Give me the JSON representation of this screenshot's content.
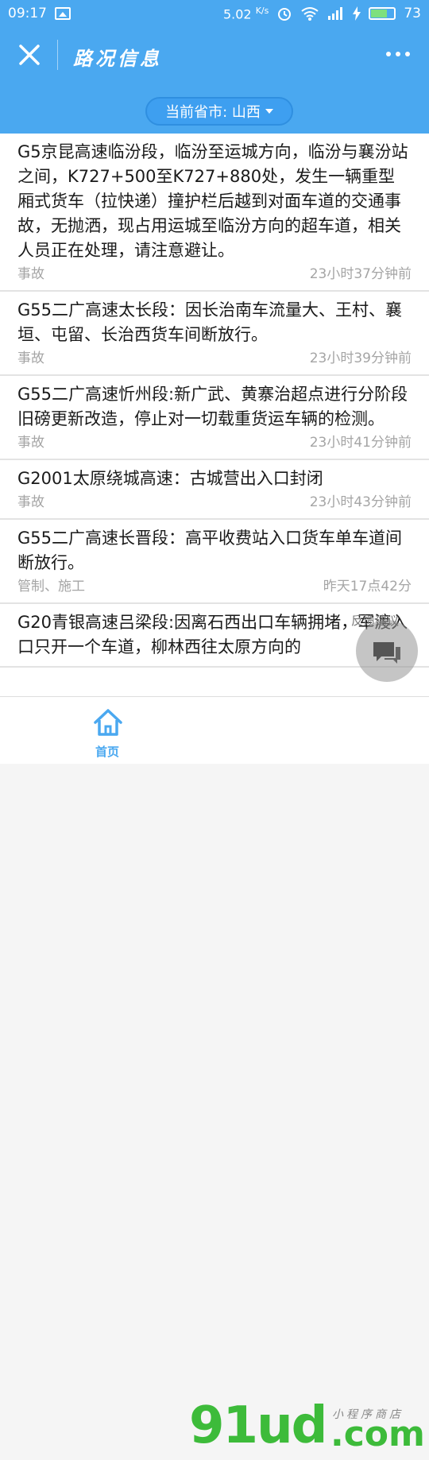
{
  "status_bar": {
    "time": "09:17",
    "speed": "5.02",
    "speed_unit": "K/s",
    "battery": "73",
    "battery_level": 0.73
  },
  "header": {
    "title": "路况信息",
    "province_label": "当前省市: 山西"
  },
  "items": [
    {
      "text": "G5京昆高速临汾段，临汾至运城方向，临汾与襄汾站之间，K727+500至K727+880处，发生一辆重型厢式货车（拉快递）撞护栏后越到对面车道的交通事故，无抛洒，现占用运城至临汾方向的超车道，相关人员正在处理，请注意避让。",
      "type": "事故",
      "time": "23小时37分钟前"
    },
    {
      "text": "G55二广高速太长段：因长治南车流量大、王村、襄垣、屯留、长治西货车间断放行。",
      "type": "事故",
      "time": "23小时39分钟前"
    },
    {
      "text": "G55二广高速忻州段:新广武、黄寨治超点进行分阶段旧磅更新改造，停止对一切载重货运车辆的检测。",
      "type": "事故",
      "time": "23小时41分钟前"
    },
    {
      "text": "G2001太原绕城高速：古城营出入口封闭",
      "type": "事故",
      "time": "23小时43分钟前"
    },
    {
      "text": "G55二广高速长晋段：高平收费站入口货车单车道间断放行。",
      "type": "管制、施工",
      "time": "昨天17点42分"
    },
    {
      "text": "G20青银高速吕梁段:因离石西出口车辆拥堵，军渡入口只开一个车道，柳林西往太原方向的",
      "type": "",
      "time": ""
    }
  ],
  "feedback": {
    "label": "反馈建议"
  },
  "tabbar": {
    "home_label": "首页"
  },
  "watermark": {
    "main": "91ud",
    "domain": ".com",
    "small": "小程序商店"
  },
  "colors": {
    "primary": "#4aa8f0",
    "watermark_green": "#3dbb3a"
  },
  "icons": [
    "photo-icon",
    "alarm-icon",
    "wifi-icon",
    "signal-icon",
    "charging-icon",
    "battery-icon",
    "close-icon",
    "more-icon",
    "chat-bubble-icon",
    "home-icon"
  ]
}
